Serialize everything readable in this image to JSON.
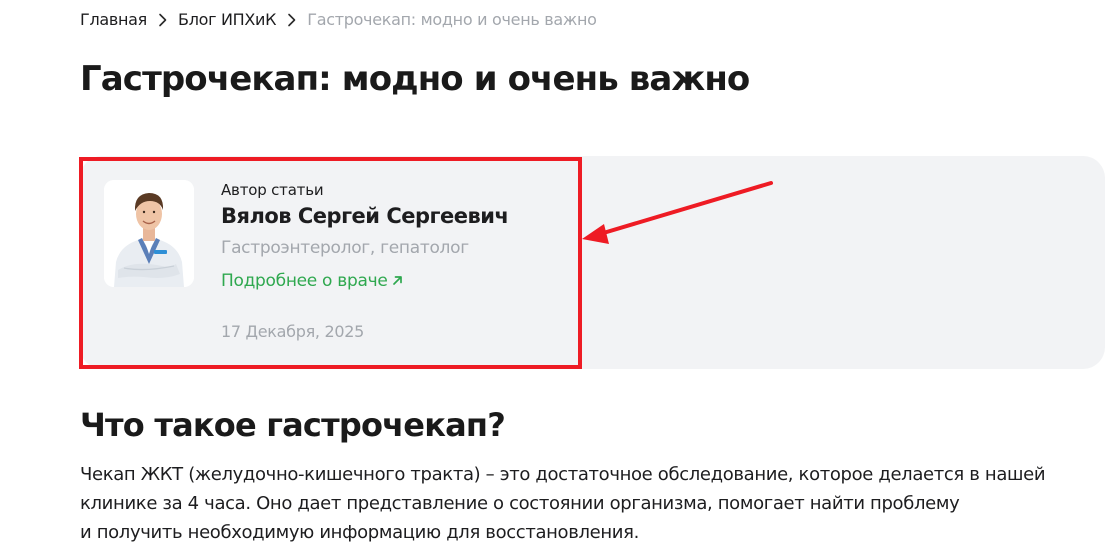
{
  "breadcrumbs": {
    "items": [
      {
        "label": "Главная"
      },
      {
        "label": "Блог ИПХиК"
      },
      {
        "label": "Гастрочекап: модно и очень важно"
      }
    ]
  },
  "page": {
    "title": "Гастрочекап: модно и очень важно"
  },
  "author": {
    "label": "Автор статьи",
    "name": "Вялов Сергей Сергеевич",
    "role": "Гастроэнтеролог, гепатолог",
    "link_label": "Подробнее о враче",
    "link_icon": "arrow-up-right-icon",
    "date": "17 Декабря, 2025"
  },
  "section": {
    "heading": "Что такое гастрочекап?",
    "paragraph_lines": [
      "Чекап ЖКТ (желудочно-кишечного тракта) – это достаточное обследование, которое делается в нашей",
      "клинике за 4 часа. Оно дает представление о состоянии организма, помогает найти проблему",
      "и получить необходимую информацию для восстановления."
    ]
  },
  "colors": {
    "accent_green": "#2fa84f",
    "muted_gray": "#a3a7ad",
    "card_bg": "#f2f3f5",
    "annotation_red": "#ee1b24"
  }
}
